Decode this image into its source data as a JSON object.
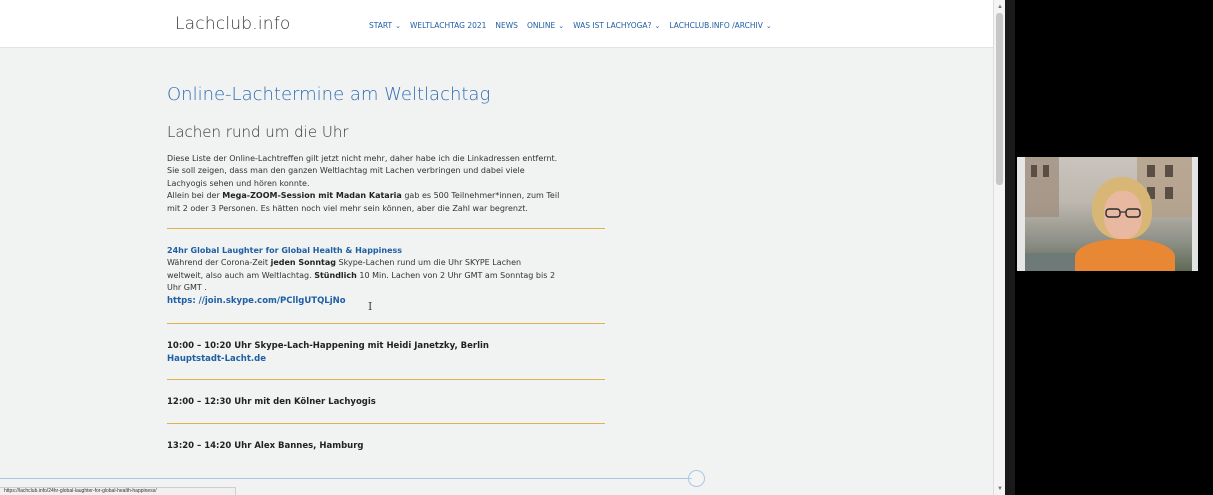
{
  "site": {
    "logo": "Lachclub.info",
    "nav": [
      {
        "label": "START",
        "has_menu": true
      },
      {
        "label": "WELTLACHTAG 2021",
        "has_menu": false
      },
      {
        "label": "NEWS",
        "has_menu": false
      },
      {
        "label": "ONLINE",
        "has_menu": true
      },
      {
        "label": "WAS IST LACHYOGA?",
        "has_menu": true
      },
      {
        "label": "LACHCLUB.INFO /ARCHIV",
        "has_menu": true
      }
    ]
  },
  "article": {
    "title": "Online-Lachtermine am Weltlachtag",
    "subtitle": "Lachen rund um die Uhr",
    "intro_line1": "Diese Liste der Online-Lachtreffen gilt jetzt nicht mehr, daher habe ich die Linkadressen entfernt.",
    "intro_line2": "Sie soll zeigen, dass man den ganzen Weltlachtag mit Lachen verbringen und dabei viele",
    "intro_line3": "Lachyogis sehen und hören konnte.",
    "intro_line4_pre": "Allein bei der ",
    "intro_line4_bold": "Mega-ZOOM-Session mit Madan Kataria",
    "intro_line4_post": " gab es 500 Teilnehmer*innen, zum Teil",
    "intro_line5": "mit 2 oder 3 Personen. Es hätten noch viel mehr sein können, aber die Zahl war begrenzt.",
    "global": {
      "title": "24hr Global Laughter for Global Health & Happiness",
      "line1_pre": "Während der Corona-Zeit ",
      "line1_bold": "jeden Sonntag",
      "line1_post": " Skype-Lachen rund um die Uhr SKYPE Lachen",
      "line2_pre": "weltweit, also auch am Weltlachtag. ",
      "line2_bold": "Stündlich",
      "line2_post": " 10 Min. Lachen von 2 Uhr GMT am Sonntag bis 2",
      "line3": "Uhr GMT .",
      "link": "https: //join.skype.com/PCllgUTQLjNo"
    },
    "events": [
      {
        "text": "10:00 – 10:20 Uhr Skype-Lach-Happening mit Heidi Janetzky, Berlin",
        "link": "Hauptstadt-Lacht.de"
      },
      {
        "text": "12:00 – 12:30 Uhr mit den Kölner Lachyogis",
        "link": ""
      },
      {
        "text": "13:20 – 14:20 Uhr  Alex Bannes, Hamburg",
        "link": ""
      }
    ]
  },
  "status_url": "https://lachclub.info/24hr-global-laughter-for-global-health-happiness/",
  "cursor_glyph": "I"
}
